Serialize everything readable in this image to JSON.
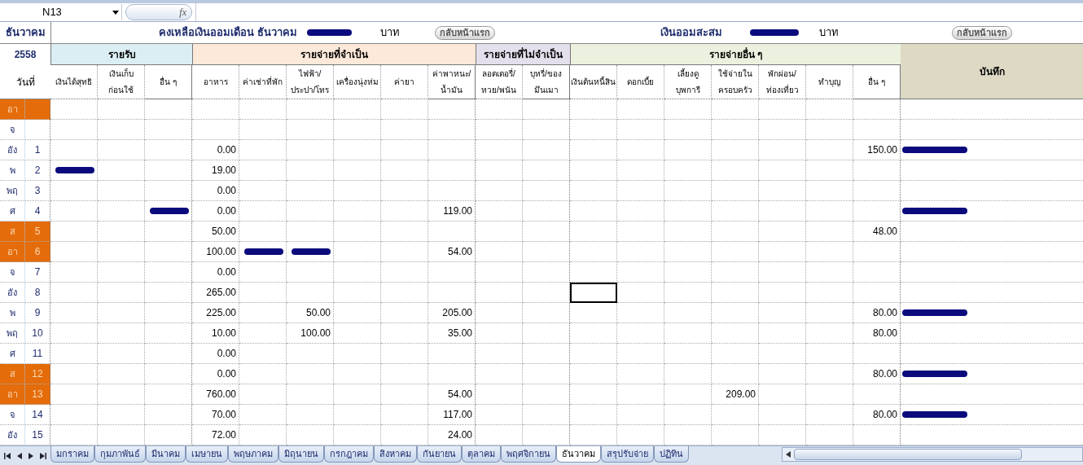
{
  "formula_bar": {
    "name_box": "N13",
    "fx": "fx"
  },
  "sheet": {
    "month": "ธันวาคม",
    "year": "2558",
    "day_header": "วันที่",
    "summary": [
      {
        "label": "คงเหลือเงินออมเดือน ธันวาคม",
        "amount": {
          "kind": "redacted"
        },
        "unit": "บาท",
        "button": "กลับหน้าแรก"
      },
      {
        "label": "เงินออมสะสม",
        "amount": {
          "kind": "redacted"
        },
        "unit": "บาท",
        "button": "กลับหน้าแรก"
      }
    ],
    "groups": [
      {
        "label": "รายรับ",
        "color": "#dbeef3",
        "columns": [
          "เงินได้สุทธิ",
          "เงินเก็บ\nก่อนใช้",
          "อื่น ๆ"
        ]
      },
      {
        "label": "รายจ่ายที่จำเป็น",
        "color": "#fde9d9",
        "columns": [
          "อาหาร",
          "ค่าเช่าที่พัก",
          "ไฟฟ้า/\nประปา/โทร",
          "เครื่องนุ่งห่ม",
          "ค่ายา",
          "ค่าพาหนะ/\nน้ำมัน"
        ]
      },
      {
        "label": "รายจ่ายที่ไม่จำเป็น",
        "color": "#e4dfec",
        "columns": [
          "ลอตเตอรี่/\nหวย/พนัน",
          "บุหรี่/ของ\nมึนเมา"
        ]
      },
      {
        "label": "รายจ่ายอื่น ๆ",
        "color": "#ebf1de",
        "columns": [
          "เงินต้นหนี้สิน",
          "ดอกเบี้ย",
          "เลี้ยงดู\nบุพการี",
          "ใช้จ่ายใน\nครอบครัว",
          "พักผ่อน/\nท่องเที่ยว",
          "ทำบุญ",
          "อื่น ๆ"
        ]
      }
    ],
    "notes_header": "บันทึก",
    "rows": [
      {
        "day": "อา",
        "weekend": true,
        "cells": [
          {
            "kind": "blank"
          },
          {
            "kind": "blank"
          },
          {
            "kind": "blank"
          },
          {
            "kind": "blank"
          },
          {
            "kind": "blank"
          },
          {
            "kind": "blank"
          },
          {
            "kind": "blank"
          },
          {
            "kind": "blank"
          },
          {
            "kind": "blank"
          },
          {
            "kind": "blank"
          },
          {
            "kind": "blank"
          },
          {
            "kind": "blank"
          },
          {
            "kind": "blank"
          },
          {
            "kind": "blank"
          },
          {
            "kind": "blank"
          },
          {
            "kind": "blank"
          },
          {
            "kind": "blank"
          },
          {
            "kind": "blank"
          },
          {
            "kind": "blank"
          }
        ]
      },
      {
        "day": "จ",
        "weekend": false,
        "cells": [
          {
            "kind": "blank"
          },
          {
            "kind": "blank"
          },
          {
            "kind": "blank"
          },
          {
            "kind": "blank"
          },
          {
            "kind": "blank"
          },
          {
            "kind": "blank"
          },
          {
            "kind": "blank"
          },
          {
            "kind": "blank"
          },
          {
            "kind": "blank"
          },
          {
            "kind": "blank"
          },
          {
            "kind": "blank"
          },
          {
            "kind": "blank"
          },
          {
            "kind": "blank"
          },
          {
            "kind": "blank"
          },
          {
            "kind": "blank"
          },
          {
            "kind": "blank"
          },
          {
            "kind": "blank"
          },
          {
            "kind": "blank"
          },
          {
            "kind": "blank"
          }
        ]
      },
      {
        "day": "อัง",
        "date": "1",
        "weekend": false,
        "cells": [
          {
            "kind": "blank"
          },
          {
            "kind": "blank"
          },
          {
            "kind": "blank"
          },
          {
            "text": "0.00"
          },
          {
            "kind": "blank"
          },
          {
            "kind": "blank"
          },
          {
            "kind": "blank"
          },
          {
            "kind": "blank"
          },
          {
            "kind": "blank"
          },
          {
            "kind": "blank"
          },
          {
            "kind": "blank"
          },
          {
            "kind": "blank"
          },
          {
            "kind": "blank"
          },
          {
            "kind": "blank"
          },
          {
            "kind": "blank"
          },
          {
            "kind": "blank"
          },
          {
            "kind": "blank"
          },
          {
            "text": "150.00"
          },
          {
            "kind": "redacted"
          }
        ]
      },
      {
        "day": "พ",
        "date": "2",
        "weekend": false,
        "cells": [
          {
            "kind": "redacted"
          },
          {
            "kind": "blank"
          },
          {
            "kind": "blank"
          },
          {
            "text": "19.00"
          },
          {
            "kind": "blank"
          },
          {
            "kind": "blank"
          },
          {
            "kind": "blank"
          },
          {
            "kind": "blank"
          },
          {
            "kind": "blank"
          },
          {
            "kind": "blank"
          },
          {
            "kind": "blank"
          },
          {
            "kind": "blank"
          },
          {
            "kind": "blank"
          },
          {
            "kind": "blank"
          },
          {
            "kind": "blank"
          },
          {
            "kind": "blank"
          },
          {
            "kind": "blank"
          },
          {
            "kind": "blank"
          },
          {
            "kind": "blank"
          }
        ]
      },
      {
        "day": "พฤ",
        "date": "3",
        "weekend": false,
        "cells": [
          {
            "kind": "blank"
          },
          {
            "kind": "blank"
          },
          {
            "kind": "blank"
          },
          {
            "text": "0.00"
          },
          {
            "kind": "blank"
          },
          {
            "kind": "blank"
          },
          {
            "kind": "blank"
          },
          {
            "kind": "blank"
          },
          {
            "kind": "blank"
          },
          {
            "kind": "blank"
          },
          {
            "kind": "blank"
          },
          {
            "kind": "blank"
          },
          {
            "kind": "blank"
          },
          {
            "kind": "blank"
          },
          {
            "kind": "blank"
          },
          {
            "kind": "blank"
          },
          {
            "kind": "blank"
          },
          {
            "kind": "blank"
          },
          {
            "kind": "blank"
          }
        ]
      },
      {
        "day": "ศ",
        "date": "4",
        "weekend": false,
        "cells": [
          {
            "kind": "blank"
          },
          {
            "kind": "blank"
          },
          {
            "kind": "redacted"
          },
          {
            "text": "0.00"
          },
          {
            "kind": "blank"
          },
          {
            "kind": "blank"
          },
          {
            "kind": "blank"
          },
          {
            "kind": "blank"
          },
          {
            "text": "119.00"
          },
          {
            "kind": "blank"
          },
          {
            "kind": "blank"
          },
          {
            "kind": "blank"
          },
          {
            "kind": "blank"
          },
          {
            "kind": "blank"
          },
          {
            "kind": "blank"
          },
          {
            "kind": "blank"
          },
          {
            "kind": "blank"
          },
          {
            "kind": "blank"
          },
          {
            "kind": "redacted"
          }
        ]
      },
      {
        "day": "ส",
        "date": "5",
        "weekend": true,
        "cells": [
          {
            "kind": "blank"
          },
          {
            "kind": "blank"
          },
          {
            "kind": "blank"
          },
          {
            "text": "50.00"
          },
          {
            "kind": "blank"
          },
          {
            "kind": "blank"
          },
          {
            "kind": "blank"
          },
          {
            "kind": "blank"
          },
          {
            "kind": "blank"
          },
          {
            "kind": "blank"
          },
          {
            "kind": "blank"
          },
          {
            "kind": "blank"
          },
          {
            "kind": "blank"
          },
          {
            "kind": "blank"
          },
          {
            "kind": "blank"
          },
          {
            "kind": "blank"
          },
          {
            "kind": "blank"
          },
          {
            "text": "48.00"
          },
          {
            "kind": "blank"
          }
        ]
      },
      {
        "day": "อา",
        "date": "6",
        "weekend": true,
        "cells": [
          {
            "kind": "blank"
          },
          {
            "kind": "blank"
          },
          {
            "kind": "blank"
          },
          {
            "text": "100.00"
          },
          {
            "kind": "redacted"
          },
          {
            "kind": "redacted"
          },
          {
            "kind": "blank"
          },
          {
            "kind": "blank"
          },
          {
            "text": "54.00"
          },
          {
            "kind": "blank"
          },
          {
            "kind": "blank"
          },
          {
            "kind": "blank"
          },
          {
            "kind": "blank"
          },
          {
            "kind": "blank"
          },
          {
            "kind": "blank"
          },
          {
            "kind": "blank"
          },
          {
            "kind": "blank"
          },
          {
            "kind": "blank"
          },
          {
            "kind": "blank"
          }
        ]
      },
      {
        "day": "จ",
        "date": "7",
        "weekend": false,
        "cells": [
          {
            "kind": "blank"
          },
          {
            "kind": "blank"
          },
          {
            "kind": "blank"
          },
          {
            "text": "0.00"
          },
          {
            "kind": "blank"
          },
          {
            "kind": "blank"
          },
          {
            "kind": "blank"
          },
          {
            "kind": "blank"
          },
          {
            "kind": "blank"
          },
          {
            "kind": "blank"
          },
          {
            "kind": "blank"
          },
          {
            "kind": "blank"
          },
          {
            "kind": "blank"
          },
          {
            "kind": "blank"
          },
          {
            "kind": "blank"
          },
          {
            "kind": "blank"
          },
          {
            "kind": "blank"
          },
          {
            "kind": "blank"
          },
          {
            "kind": "blank"
          }
        ]
      },
      {
        "day": "อัง",
        "date": "8",
        "weekend": false,
        "cells": [
          {
            "kind": "blank"
          },
          {
            "kind": "blank"
          },
          {
            "kind": "blank"
          },
          {
            "text": "265.00"
          },
          {
            "kind": "blank"
          },
          {
            "kind": "blank"
          },
          {
            "kind": "blank"
          },
          {
            "kind": "blank"
          },
          {
            "kind": "blank"
          },
          {
            "kind": "blank"
          },
          {
            "kind": "blank"
          },
          {
            "kind": "active"
          },
          {
            "kind": "blank"
          },
          {
            "kind": "blank"
          },
          {
            "kind": "blank"
          },
          {
            "kind": "blank"
          },
          {
            "kind": "blank"
          },
          {
            "kind": "blank"
          },
          {
            "kind": "blank"
          }
        ]
      },
      {
        "day": "พ",
        "date": "9",
        "weekend": false,
        "cells": [
          {
            "kind": "blank"
          },
          {
            "kind": "blank"
          },
          {
            "kind": "blank"
          },
          {
            "text": "225.00"
          },
          {
            "kind": "blank"
          },
          {
            "text": "50.00"
          },
          {
            "kind": "blank"
          },
          {
            "kind": "blank"
          },
          {
            "text": "205.00"
          },
          {
            "kind": "blank"
          },
          {
            "kind": "blank"
          },
          {
            "kind": "blank"
          },
          {
            "kind": "blank"
          },
          {
            "kind": "blank"
          },
          {
            "kind": "blank"
          },
          {
            "kind": "blank"
          },
          {
            "kind": "blank"
          },
          {
            "text": "80.00"
          },
          {
            "kind": "redacted"
          }
        ]
      },
      {
        "day": "พฤ",
        "date": "10",
        "weekend": false,
        "cells": [
          {
            "kind": "blank"
          },
          {
            "kind": "blank"
          },
          {
            "kind": "blank"
          },
          {
            "text": "10.00"
          },
          {
            "kind": "blank"
          },
          {
            "text": "100.00"
          },
          {
            "kind": "blank"
          },
          {
            "kind": "blank"
          },
          {
            "text": "35.00"
          },
          {
            "kind": "blank"
          },
          {
            "kind": "blank"
          },
          {
            "kind": "blank"
          },
          {
            "kind": "blank"
          },
          {
            "kind": "blank"
          },
          {
            "kind": "blank"
          },
          {
            "kind": "blank"
          },
          {
            "kind": "blank"
          },
          {
            "text": "80.00"
          },
          {
            "kind": "blank"
          }
        ]
      },
      {
        "day": "ศ",
        "date": "11",
        "weekend": false,
        "cells": [
          {
            "kind": "blank"
          },
          {
            "kind": "blank"
          },
          {
            "kind": "blank"
          },
          {
            "text": "0.00"
          },
          {
            "kind": "blank"
          },
          {
            "kind": "blank"
          },
          {
            "kind": "blank"
          },
          {
            "kind": "blank"
          },
          {
            "kind": "blank"
          },
          {
            "kind": "blank"
          },
          {
            "kind": "blank"
          },
          {
            "kind": "blank"
          },
          {
            "kind": "blank"
          },
          {
            "kind": "blank"
          },
          {
            "kind": "blank"
          },
          {
            "kind": "blank"
          },
          {
            "kind": "blank"
          },
          {
            "kind": "blank"
          },
          {
            "kind": "blank"
          }
        ]
      },
      {
        "day": "ส",
        "date": "12",
        "weekend": true,
        "cells": [
          {
            "kind": "blank"
          },
          {
            "kind": "blank"
          },
          {
            "kind": "blank"
          },
          {
            "text": "0.00"
          },
          {
            "kind": "blank"
          },
          {
            "kind": "blank"
          },
          {
            "kind": "blank"
          },
          {
            "kind": "blank"
          },
          {
            "kind": "blank"
          },
          {
            "kind": "blank"
          },
          {
            "kind": "blank"
          },
          {
            "kind": "blank"
          },
          {
            "kind": "blank"
          },
          {
            "kind": "blank"
          },
          {
            "kind": "blank"
          },
          {
            "kind": "blank"
          },
          {
            "kind": "blank"
          },
          {
            "text": "80.00"
          },
          {
            "kind": "redacted"
          }
        ]
      },
      {
        "day": "อา",
        "date": "13",
        "weekend": true,
        "cells": [
          {
            "kind": "blank"
          },
          {
            "kind": "blank"
          },
          {
            "kind": "blank"
          },
          {
            "text": "760.00"
          },
          {
            "kind": "blank"
          },
          {
            "kind": "blank"
          },
          {
            "kind": "blank"
          },
          {
            "kind": "blank"
          },
          {
            "text": "54.00"
          },
          {
            "kind": "blank"
          },
          {
            "kind": "blank"
          },
          {
            "kind": "blank"
          },
          {
            "kind": "blank"
          },
          {
            "kind": "blank"
          },
          {
            "text": "209.00"
          },
          {
            "kind": "blank"
          },
          {
            "kind": "blank"
          },
          {
            "kind": "blank"
          },
          {
            "kind": "blank"
          }
        ]
      },
      {
        "day": "จ",
        "date": "14",
        "weekend": false,
        "cells": [
          {
            "kind": "blank"
          },
          {
            "kind": "blank"
          },
          {
            "kind": "blank"
          },
          {
            "text": "70.00"
          },
          {
            "kind": "blank"
          },
          {
            "kind": "blank"
          },
          {
            "kind": "blank"
          },
          {
            "kind": "blank"
          },
          {
            "text": "117.00"
          },
          {
            "kind": "blank"
          },
          {
            "kind": "blank"
          },
          {
            "kind": "blank"
          },
          {
            "kind": "blank"
          },
          {
            "kind": "blank"
          },
          {
            "kind": "blank"
          },
          {
            "kind": "blank"
          },
          {
            "kind": "blank"
          },
          {
            "text": "80.00"
          },
          {
            "kind": "redacted"
          }
        ]
      },
      {
        "day": "อัง",
        "date": "15",
        "weekend": false,
        "cells": [
          {
            "kind": "blank"
          },
          {
            "kind": "blank"
          },
          {
            "kind": "blank"
          },
          {
            "text": "72.00"
          },
          {
            "kind": "blank"
          },
          {
            "kind": "blank"
          },
          {
            "kind": "blank"
          },
          {
            "kind": "blank"
          },
          {
            "text": "24.00"
          },
          {
            "kind": "blank"
          },
          {
            "kind": "blank"
          },
          {
            "kind": "blank"
          },
          {
            "kind": "blank"
          },
          {
            "kind": "blank"
          },
          {
            "kind": "blank"
          },
          {
            "kind": "blank"
          },
          {
            "kind": "blank"
          },
          {
            "kind": "blank"
          },
          {
            "kind": "blank"
          }
        ]
      }
    ]
  },
  "tabs": [
    {
      "label": "มกราคม",
      "selected": false
    },
    {
      "label": "กุมภาพันธ์",
      "selected": false
    },
    {
      "label": "มีนาคม",
      "selected": false
    },
    {
      "label": "เมษายน",
      "selected": false
    },
    {
      "label": "พฤษภาคม",
      "selected": false
    },
    {
      "label": "มิถุนายน",
      "selected": false
    },
    {
      "label": "กรกฎาคม",
      "selected": false
    },
    {
      "label": "สิงหาคม",
      "selected": false
    },
    {
      "label": "กันยายน",
      "selected": false
    },
    {
      "label": "ตุลาคม",
      "selected": false
    },
    {
      "label": "พฤศจิกายน",
      "selected": false
    },
    {
      "label": "ธันวาคม",
      "selected": true
    },
    {
      "label": "สรุปรับจ่าย",
      "selected": false
    },
    {
      "label": "ปฏิทิน",
      "selected": false
    }
  ]
}
